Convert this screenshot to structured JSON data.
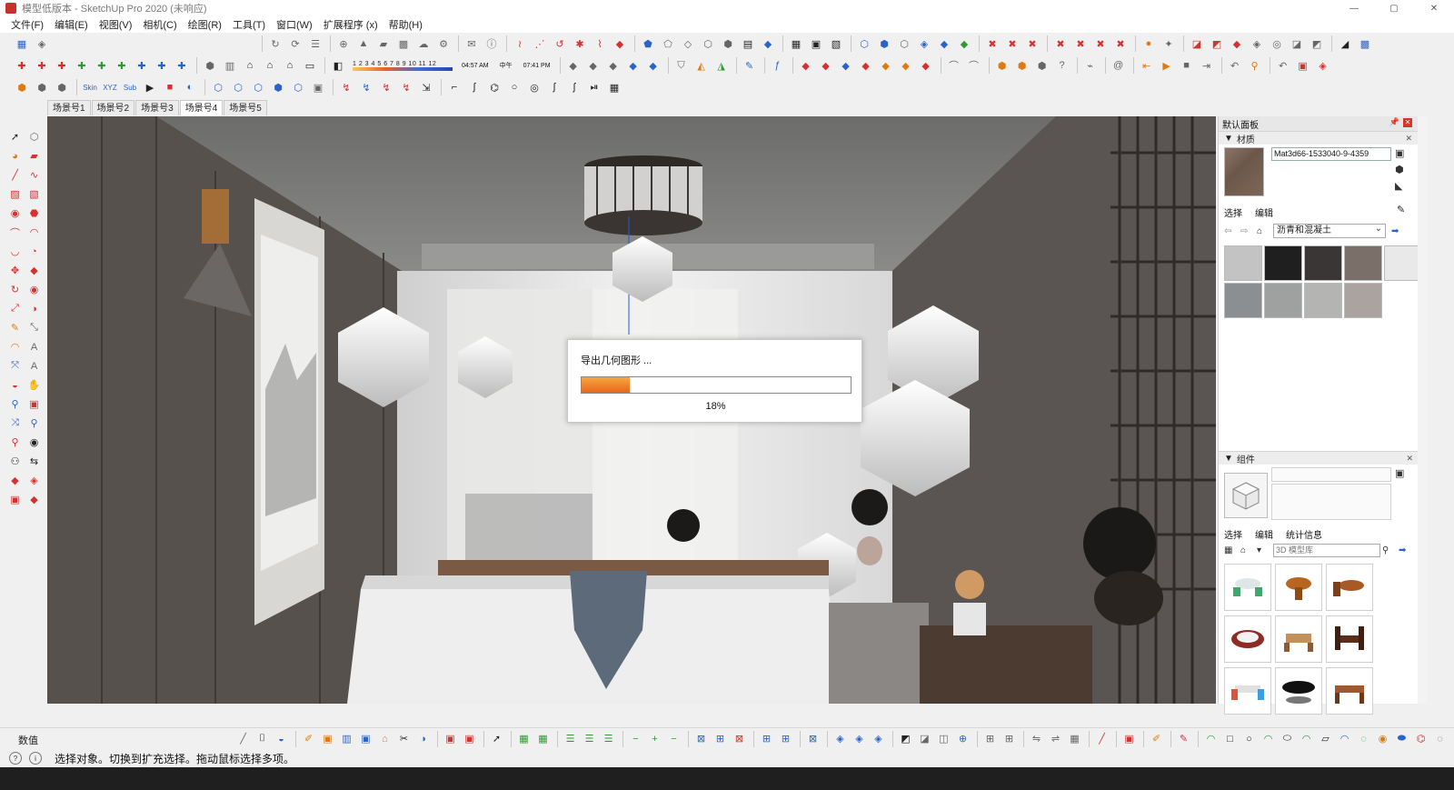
{
  "window": {
    "title": "模型低版本 - SketchUp Pro 2020 (未响应)"
  },
  "menu": [
    "文件(F)",
    "编辑(E)",
    "视图(V)",
    "相机(C)",
    "绘图(R)",
    "工具(T)",
    "窗口(W)",
    "扩展程序 (x)",
    "帮助(H)"
  ],
  "shadow_settings": {
    "months": "1 2 3 4 5 6 7 8 9 10 11 12",
    "time_start": "04:57 AM",
    "time_mid": "中午",
    "time_end": "07:41 PM"
  },
  "toolbar_labels": {
    "skin": "Skin",
    "xyz": "XYZ",
    "sub": "Sub"
  },
  "scene_tabs": [
    "场景号1",
    "场景号2",
    "场景号3",
    "场景号4",
    "场景号5"
  ],
  "active_scene_index": 3,
  "export_dialog": {
    "title": "导出几何图形 ...",
    "progress_text": "18%",
    "progress_fraction": 0.18
  },
  "right_panel": {
    "tray_title": "默认面板",
    "materials": {
      "section_title": "材质",
      "material_name": "Mat3d66-1533040-9-4359",
      "tab_select": "选择",
      "tab_edit": "编辑",
      "collection": "沥青和混凝土"
    },
    "components": {
      "section_title": "组件",
      "tab_select": "选择",
      "tab_edit": "编辑",
      "tab_stats": "统计信息",
      "search_placeholder": "3D 模型库"
    }
  },
  "measurements_label": "数值",
  "status_text": "选择对象。切换到扩充选择。拖动鼠标选择多项。",
  "colors": {
    "accent_progress": "#e8661c",
    "close_red": "#d9342b",
    "wall_dark": "#5b5855"
  },
  "icons": {
    "select_tool": "select-arrow-icon",
    "eraser_tool": "eraser-icon",
    "pencil_tool": "pencil-icon",
    "paint_tool": "paint-bucket-icon",
    "orbit_tool": "orbit-icon",
    "zoom_tool": "zoom-icon"
  }
}
